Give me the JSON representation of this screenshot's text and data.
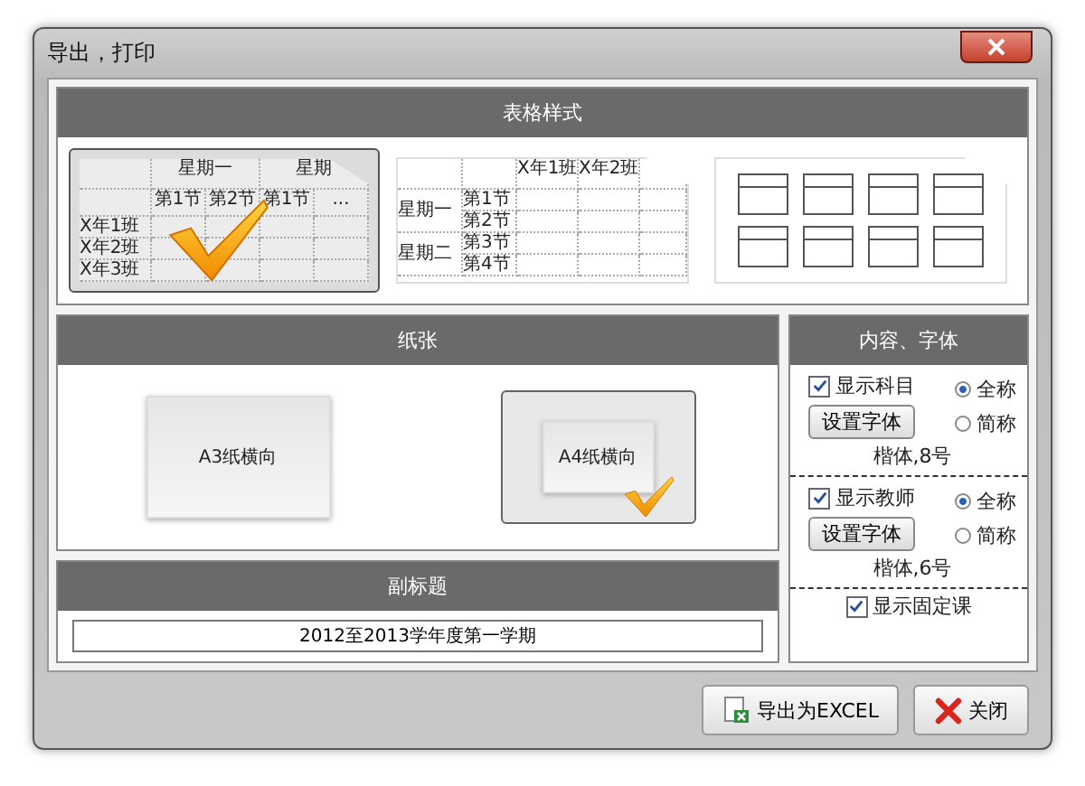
{
  "window": {
    "title": "导出，打印"
  },
  "table_style": {
    "title": "表格样式",
    "options": [
      {
        "kind": "by-class",
        "selected": true,
        "day_headers": [
          "星期一",
          "星期"
        ],
        "period_headers": [
          "第1节",
          "第2节",
          "第1节",
          "..."
        ],
        "row_labels": [
          "X年1班",
          "X年2班",
          "X年3班"
        ]
      },
      {
        "kind": "by-day",
        "selected": false,
        "class_headers": [
          "X年1班",
          "X年2班"
        ],
        "days": [
          {
            "label": "星期一",
            "periods": [
              "第1节",
              "第2节"
            ]
          },
          {
            "label": "星期二",
            "periods": [
              "第3节",
              "第4节"
            ]
          }
        ]
      },
      {
        "kind": "cards",
        "selected": false
      }
    ]
  },
  "paper": {
    "title": "纸张",
    "options": [
      {
        "label": "A3纸横向",
        "selected": false
      },
      {
        "label": "A4纸横向",
        "selected": true
      }
    ]
  },
  "subtitle": {
    "title": "副标题",
    "value": "2012至2013学年度第一学期"
  },
  "content_font": {
    "title": "内容、字体",
    "groups": [
      {
        "label": "显示科目",
        "checked": true,
        "options": [
          {
            "label": "全称",
            "selected": true
          },
          {
            "label": "简称",
            "selected": false
          }
        ],
        "button": "设置字体",
        "font": "楷体,8号"
      },
      {
        "label": "显示教师",
        "checked": true,
        "options": [
          {
            "label": "全称",
            "selected": true
          },
          {
            "label": "简称",
            "selected": false
          }
        ],
        "button": "设置字体",
        "font": "楷体,6号"
      }
    ],
    "fixed_course": {
      "label": "显示固定课",
      "checked": true
    }
  },
  "buttons": [
    {
      "kind": "export",
      "label": "导出为EXCEL"
    },
    {
      "kind": "close",
      "label": "关闭"
    }
  ]
}
